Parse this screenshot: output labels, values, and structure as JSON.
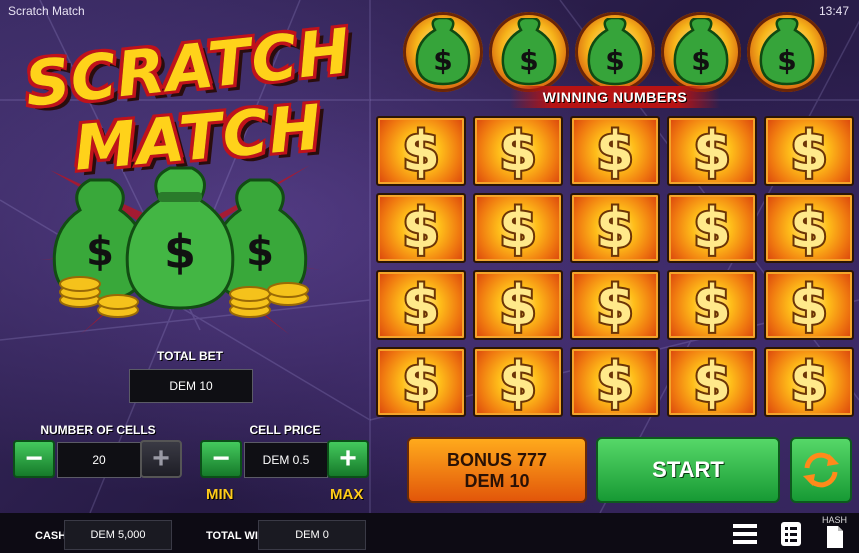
{
  "window": {
    "title": "Scratch Match",
    "clock": "13:47"
  },
  "logo": {
    "line1": "SCRATCH",
    "line2": "MATCH"
  },
  "total_bet": {
    "label": "TOTAL BET",
    "value": "DEM 10"
  },
  "cells": {
    "label": "NUMBER OF CELLS",
    "value": "20",
    "minus": "−",
    "plus": "+"
  },
  "cell_price": {
    "label": "CELL PRICE",
    "value": "DEM 0.5",
    "minus": "−",
    "plus": "+",
    "min_label": "MIN",
    "max_label": "MAX"
  },
  "winning_numbers": {
    "label": "WINNING NUMBERS",
    "count": 5,
    "symbol": "$"
  },
  "grid": {
    "rows": 4,
    "cols": 5,
    "symbol": "$"
  },
  "buttons": {
    "bonus_line1": "BONUS 777",
    "bonus_line2": "DEM 10",
    "start": "START"
  },
  "status": {
    "cash_label": "CASH",
    "cash_value": "DEM 5,000",
    "win_label": "TOTAL WIN",
    "win_value": "DEM 0",
    "hash_label": "HASH"
  },
  "colors": {
    "accent_green": "#2fb548",
    "accent_orange": "#f08a14",
    "logo_yellow": "#ffd21a",
    "logo_red": "#c0121b",
    "highlight": "#ffcc1a"
  }
}
